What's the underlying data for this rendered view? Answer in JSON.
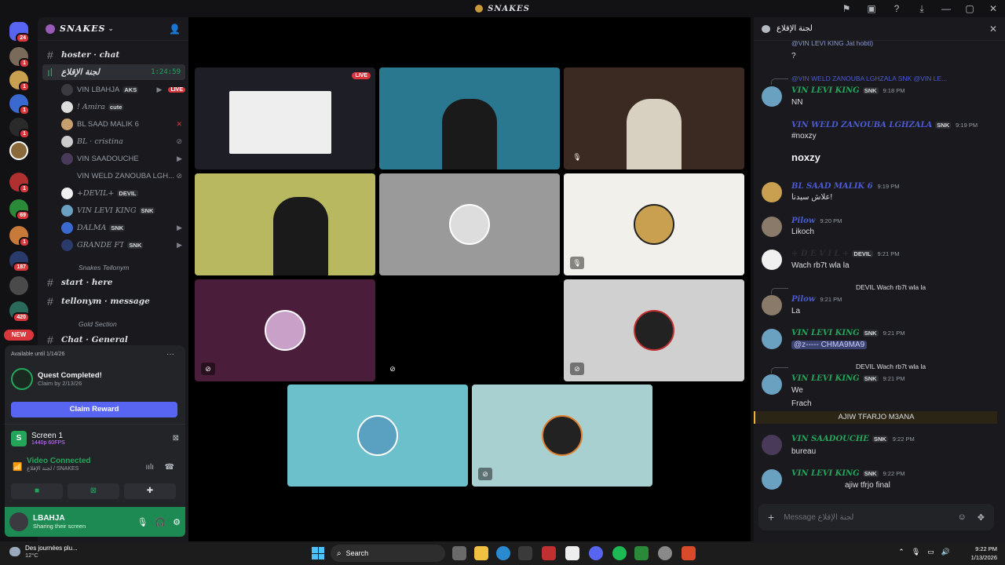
{
  "window": {
    "title": "SNAKES"
  },
  "rail": {
    "badges": [
      "24",
      "1",
      "1",
      "1",
      "1",
      "1",
      "1",
      "69",
      "1",
      "1",
      "187",
      "420"
    ],
    "new_label": "NEW"
  },
  "sidebar": {
    "guild_name": "SNAKES",
    "channels": [
      {
        "label": "hoster · chat"
      },
      {
        "label": "لجنة الإقلاع",
        "timer": "1:24:59"
      }
    ],
    "voice_users": [
      {
        "name": "VIN LBAHJA",
        "tag": "AKS",
        "live": "LIVE"
      },
      {
        "name": "! Amira",
        "tag": "cute"
      },
      {
        "name": "BL SAAD MALIK 6"
      },
      {
        "name": "BL · cristina"
      },
      {
        "name": "VIN SAADOUCHE"
      },
      {
        "name": "VIN WELD ZANOUBA LGH..."
      },
      {
        "name": "+DEVIL+",
        "tag": "DEVIL"
      },
      {
        "name": "VIN LEVI KING",
        "tag": "SNK"
      },
      {
        "name": "DALMA",
        "tag": "SNK"
      },
      {
        "name": "GRANDE FT",
        "tag": "SNK"
      }
    ],
    "cat1": "Snakes Tellonym",
    "channels2": [
      {
        "label": "start · here"
      },
      {
        "label": "tellonym · message"
      }
    ],
    "cat2": "Gold Section",
    "channel3": "Chat · General"
  },
  "quest": {
    "available": "Available until 1/14/26",
    "title": "Quest Completed!",
    "sub": "Claim by 2/13/26",
    "claim": "Claim Reward"
  },
  "screen": {
    "title": "Screen 1",
    "sub": "1440p 60FPS"
  },
  "voice": {
    "status": "Video Connected",
    "channel": "لجنة الإقلاع / SNAKES"
  },
  "user": {
    "name": "LBAHJA",
    "status": "Sharing their screen"
  },
  "stage": {
    "live_badge": "LIVE"
  },
  "chat": {
    "header": "لجنة الإقلاع",
    "input_placeholder": "Message لجنة الإقلاع",
    "messages": [
      {
        "reply": "@VIN LEVI KING Jat hobti)",
        "text": "?"
      },
      {
        "reply": "@VIN WELD ZANOUBA LGHZALA  SNK  @VIN LE...",
        "name": "VIN LEVI KING",
        "tag": "SNK",
        "time": "9:18 PM",
        "text": "NN"
      },
      {
        "name": "VIN WELD ZANOUBA LGHZALA",
        "tag": "SNK",
        "time": "9:19 PM",
        "text": "#noxzy",
        "text2": "noxzy"
      },
      {
        "name": "BL SAAD MALIK 6",
        "time": "9:19 PM",
        "text": "علاش سيدنا!"
      },
      {
        "name": "Pilow",
        "time": "9:20 PM",
        "text": "Likoch"
      },
      {
        "name": "+ D E V I L +",
        "tag": "DEVIL",
        "time": "9:21 PM",
        "text": "Wach rb7t wla la"
      },
      {
        "reply": "DEVIL  Wach rb7t wla la",
        "name": "Pilow",
        "time": "9:21 PM",
        "text": "La"
      },
      {
        "name": "VIN LEVI KING",
        "tag": "SNK",
        "time": "9:21 PM",
        "text": "@ᴢ-----          CHMA9MA9"
      },
      {
        "reply": "DEVIL  Wach rb7t wla la",
        "name": "VIN LEVI KING",
        "tag": "SNK",
        "time": "9:21 PM",
        "text": "We",
        "text2": "Frach"
      },
      {
        "banner": "AJIW TFARJO M3ANA"
      },
      {
        "name": "VIN SAADOUCHE",
        "tag": "SNK",
        "time": "9:22 PM",
        "text": "bureau"
      },
      {
        "name": "VIN LEVI KING",
        "tag": "SNK",
        "time": "9:22 PM",
        "text": "ajiw tfrjo final"
      }
    ]
  },
  "taskbar": {
    "weather_text": "Des journées plu...",
    "weather_temp": "12°C",
    "search": "Search",
    "time": "9:22 PM",
    "date": "1/13/2026"
  },
  "colors": {
    "accent": "#5865f2",
    "online": "#23a55a",
    "live": "#da373c",
    "bg": "#1a1a1e"
  }
}
